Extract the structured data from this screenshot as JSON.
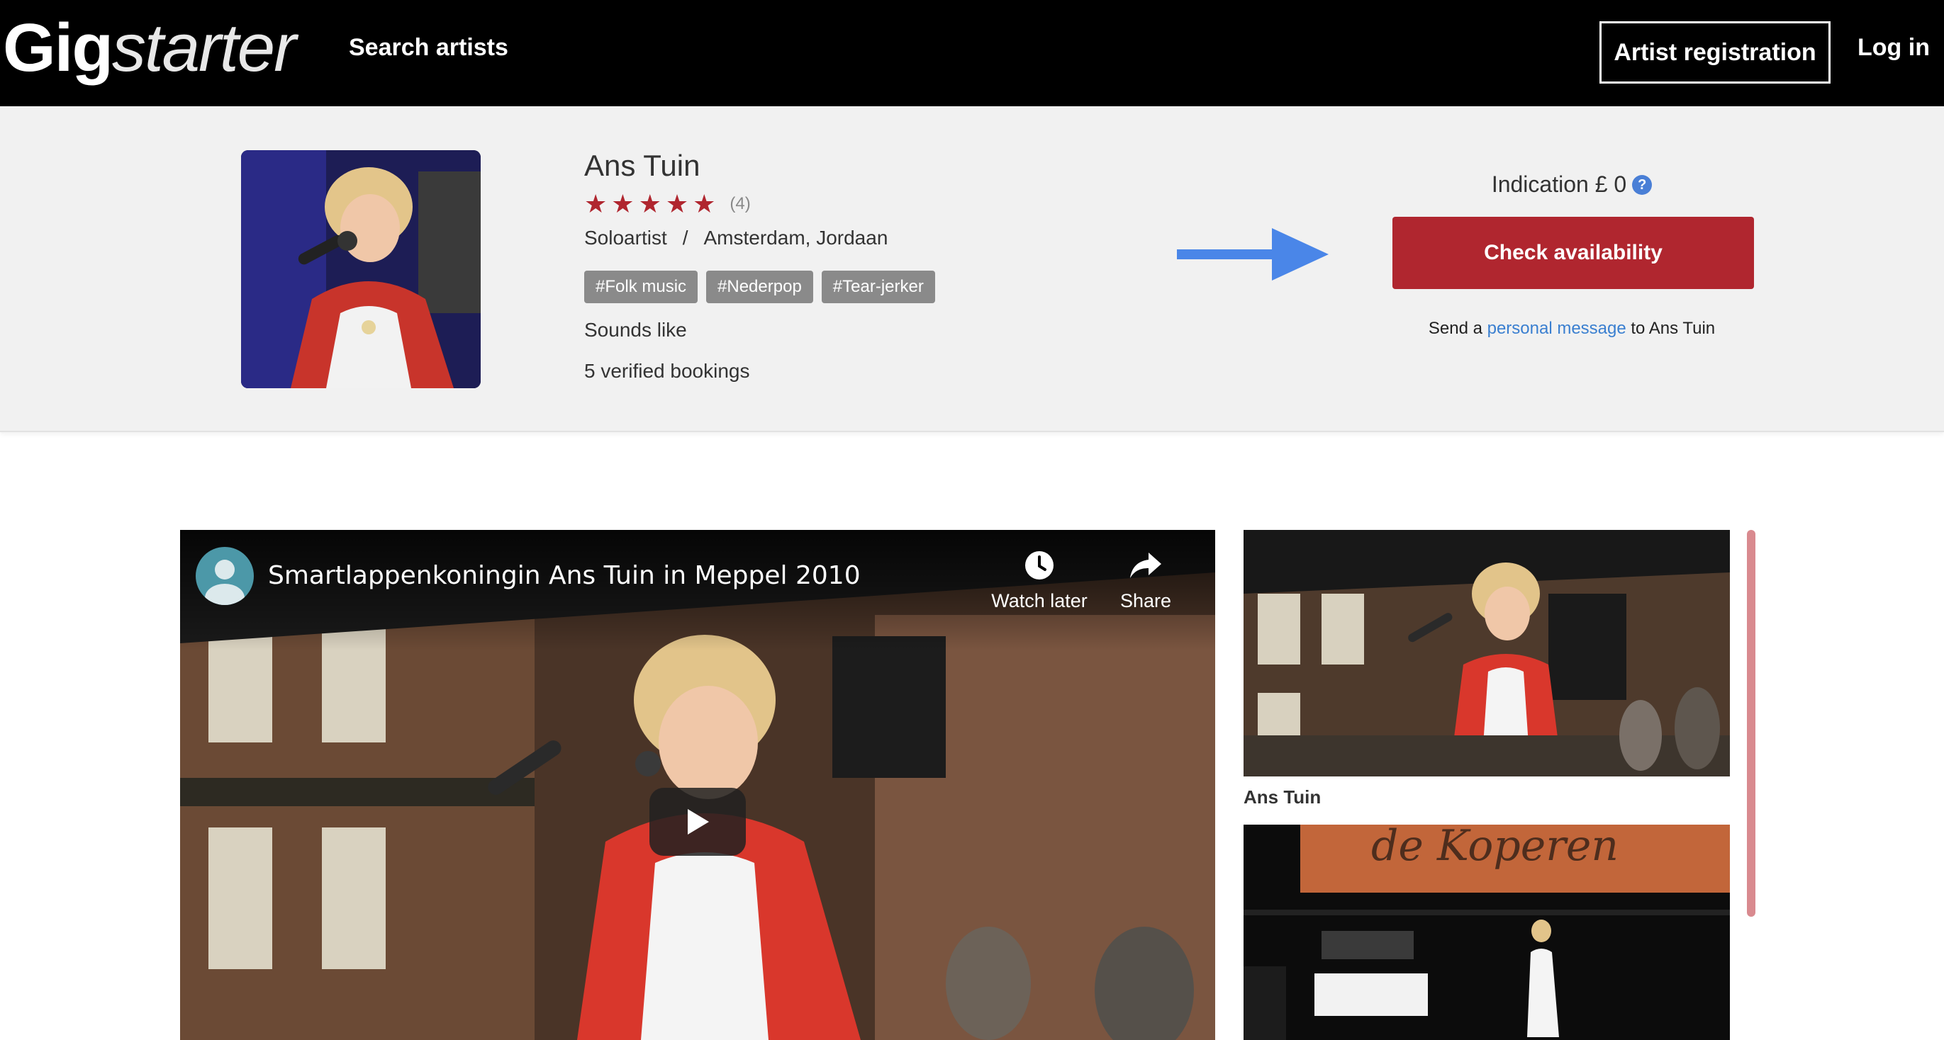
{
  "nav": {
    "logo_bold": "Gig",
    "logo_italic": "starter",
    "search_label": "Search artists",
    "register_label": "Artist registration",
    "login_label": "Log in"
  },
  "artist": {
    "name": "Ans Tuin",
    "rating_stars": 5,
    "rating_count": "(4)",
    "type": "Soloartist",
    "separator": "/",
    "location": "Amsterdam, Jordaan",
    "tags": [
      "#Folk music",
      "#Nederpop",
      "#Tear-jerker"
    ],
    "sounds_like": "Sounds like",
    "bookings": "5 verified bookings"
  },
  "booking": {
    "indication": "Indication £ 0",
    "help_glyph": "?",
    "cta_label": "Check availability",
    "message_prefix": "Send a ",
    "message_link": "personal message",
    "message_suffix": " to Ans Tuin"
  },
  "video": {
    "title": "Smartlappenkoningin Ans Tuin in Meppel 2010",
    "watch_later_label": "Watch later",
    "share_label": "Share"
  },
  "playlist": {
    "items": [
      {
        "caption": "Ans Tuin"
      }
    ]
  },
  "colors": {
    "accent_red": "#b0262f",
    "link_blue": "#3a7fd0",
    "arrow_blue": "#4a86e8",
    "hero_bg": "#f1f1f1"
  }
}
